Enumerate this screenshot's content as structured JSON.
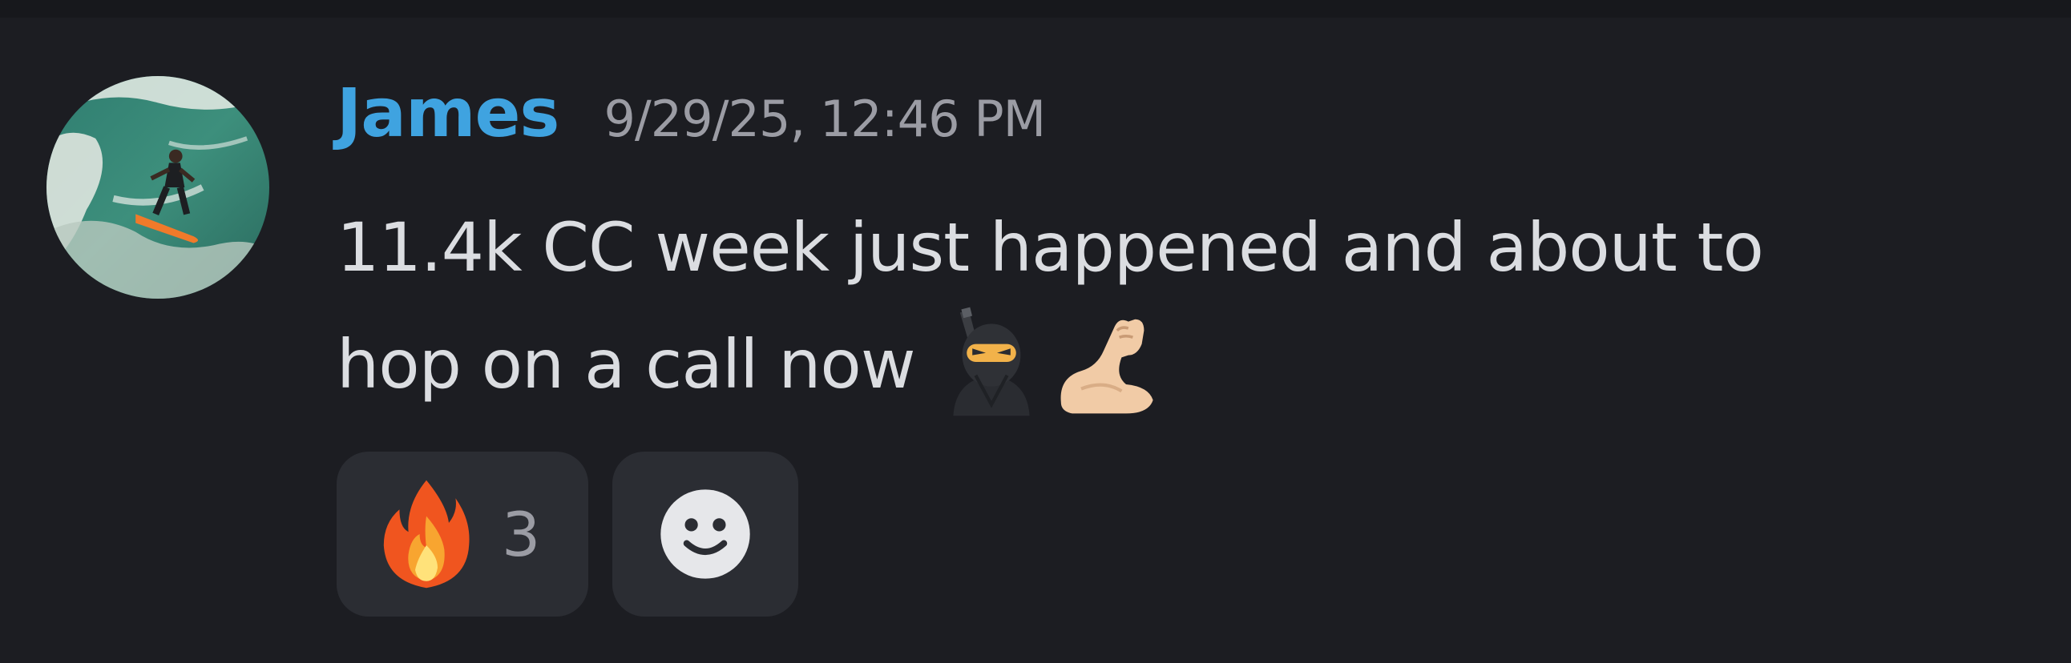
{
  "message": {
    "author": "James",
    "timestamp": "9/29/25, 12:46 PM",
    "content_lines": [
      "11.4k CC week just happened and about to",
      "hop on a call now"
    ],
    "inline_emojis": [
      "ninja-emoji",
      "flexed-biceps-emoji"
    ],
    "author_color": "#3fa3e0"
  },
  "reactions": [
    {
      "icon": "fire-emoji",
      "count": "3"
    }
  ],
  "add_reaction": {
    "icon": "smiley-add-reaction-icon"
  }
}
